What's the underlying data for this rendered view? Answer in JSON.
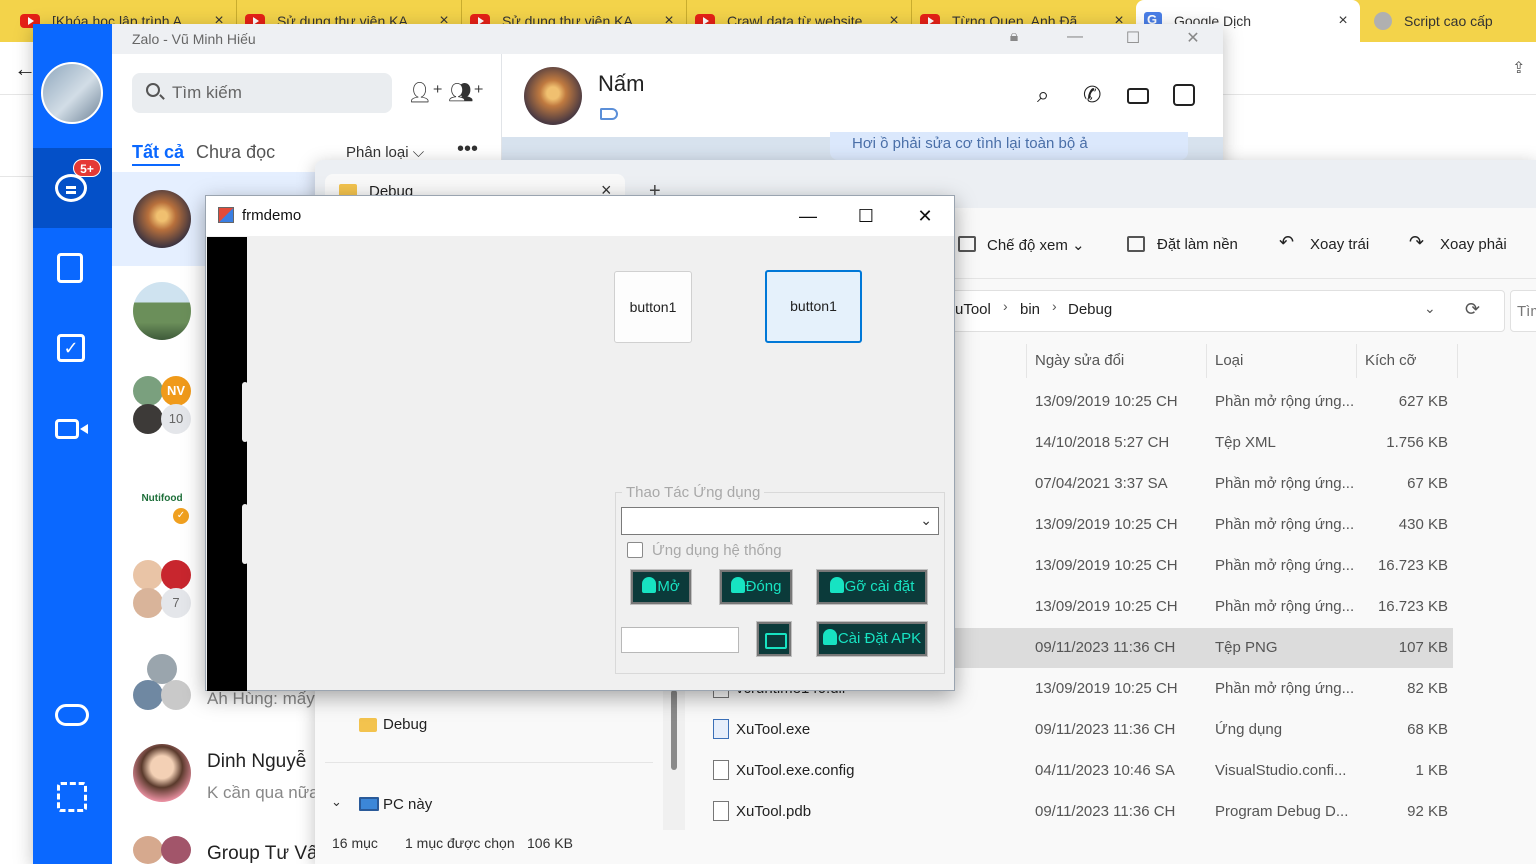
{
  "browser": {
    "tabs": [
      {
        "title": "[Khóa học lập trình A",
        "kind": "youtube"
      },
      {
        "title": "Sử dụng thư viện KA",
        "kind": "youtube"
      },
      {
        "title": "Sử dụng thư viện KA",
        "kind": "youtube"
      },
      {
        "title": "Crawl data từ website",
        "kind": "youtube"
      },
      {
        "title": "Từng Quen, Anh Đã",
        "kind": "youtube"
      },
      {
        "title": "Google Dịch",
        "kind": "translate",
        "active": true
      },
      {
        "title": "Script cao cấp",
        "kind": "extension"
      }
    ],
    "accent": "#f3d34a"
  },
  "zalo": {
    "window_title": "Zalo - Vũ Minh Hiếu",
    "unread_badge": "5+",
    "search_placeholder": "Tìm kiếm",
    "tab_all": "Tất cả",
    "tab_unread": "Chưa đọc",
    "classify_label": "Phân loại",
    "more": "•••",
    "conversations": [
      {
        "name": "",
        "message": ""
      },
      {
        "name": "",
        "message": ""
      },
      {
        "name": "",
        "message": "",
        "avatar_text": "NV",
        "count": "10"
      },
      {
        "name": "",
        "message": "",
        "avatar_text": "Nutifood"
      },
      {
        "name": "",
        "message": "",
        "count": "7"
      },
      {
        "name": "",
        "message": "Ah Hùng: mấy"
      },
      {
        "name": "Dinh Nguyễ",
        "message": "K cần qua nữa"
      },
      {
        "name": "Group Tư Vấn",
        "message": ""
      }
    ],
    "chat": {
      "contact_name": "Nấm",
      "bubble_text": "Hơi ồ phải sửa cơ tình lại toàn bộ ả"
    },
    "brand_color": "#0a68ff"
  },
  "explorer": {
    "tab_title": "Debug",
    "toolbar": {
      "view": "Chế độ xem",
      "set_background": "Đặt làm nền",
      "rotate_left": "Xoay trái",
      "rotate_right": "Xoay phải"
    },
    "breadcrumb": [
      "uTool",
      "bin",
      "Debug"
    ],
    "search_placeholder": "Tìm",
    "columns": {
      "modified": "Ngày sửa đổi",
      "type": "Loại",
      "size": "Kích cỡ"
    },
    "files": [
      {
        "name": "",
        "modified": "13/09/2019 10:25 CH",
        "type": "Phần mở rộng ứng...",
        "size": "627 KB"
      },
      {
        "name": "",
        "modified": "14/10/2018 5:27 CH",
        "type": "Tệp XML",
        "size": "1.756 KB"
      },
      {
        "name": "",
        "modified": "07/04/2021 3:37 SA",
        "type": "Phần mở rộng ứng...",
        "size": "67 KB"
      },
      {
        "name": "",
        "modified": "13/09/2019 10:25 CH",
        "type": "Phần mở rộng ứng...",
        "size": "430 KB"
      },
      {
        "name": "",
        "modified": "13/09/2019 10:25 CH",
        "type": "Phần mở rộng ứng...",
        "size": "16.723 KB"
      },
      {
        "name": "",
        "modified": "13/09/2019 10:25 CH",
        "type": "Phần mở rộng ứng...",
        "size": "16.723 KB"
      },
      {
        "name": "",
        "modified": "09/11/2023 11:36 CH",
        "type": "Tệp PNG",
        "size": "107 KB",
        "selected": true
      },
      {
        "name": "vcruntime140.dll",
        "modified": "13/09/2019 10:25 CH",
        "type": "Phần mở rộng ứng...",
        "size": "82 KB"
      },
      {
        "name": "XuTool.exe",
        "modified": "09/11/2023 11:36 CH",
        "type": "Ứng dụng",
        "size": "68 KB"
      },
      {
        "name": "XuTool.exe.config",
        "modified": "04/11/2023 10:46 SA",
        "type": "VisualStudio.confi...",
        "size": "1 KB"
      },
      {
        "name": "XuTool.pdb",
        "modified": "09/11/2023 11:36 CH",
        "type": "Program Debug D...",
        "size": "92 KB"
      }
    ],
    "nav": {
      "debug": "Debug",
      "this_pc": "PC này"
    },
    "status": {
      "count": "16 mục",
      "selected": "1 mục được chọn",
      "size": "106 KB"
    }
  },
  "frmdemo": {
    "title": "frmdemo",
    "button1_label": "button1",
    "button2_label": "button1",
    "group_label": "Thao Tác Ứng dụng",
    "combo_value": "",
    "checkbox_label": "Ứng dụng hệ thống",
    "btn_open": "Mở",
    "btn_close": "Đóng",
    "btn_uninstall": "Gỡ cài đặt",
    "btn_install_apk": "Cài Đặt APK",
    "apk_path": "",
    "accent": "#17e3c2"
  }
}
